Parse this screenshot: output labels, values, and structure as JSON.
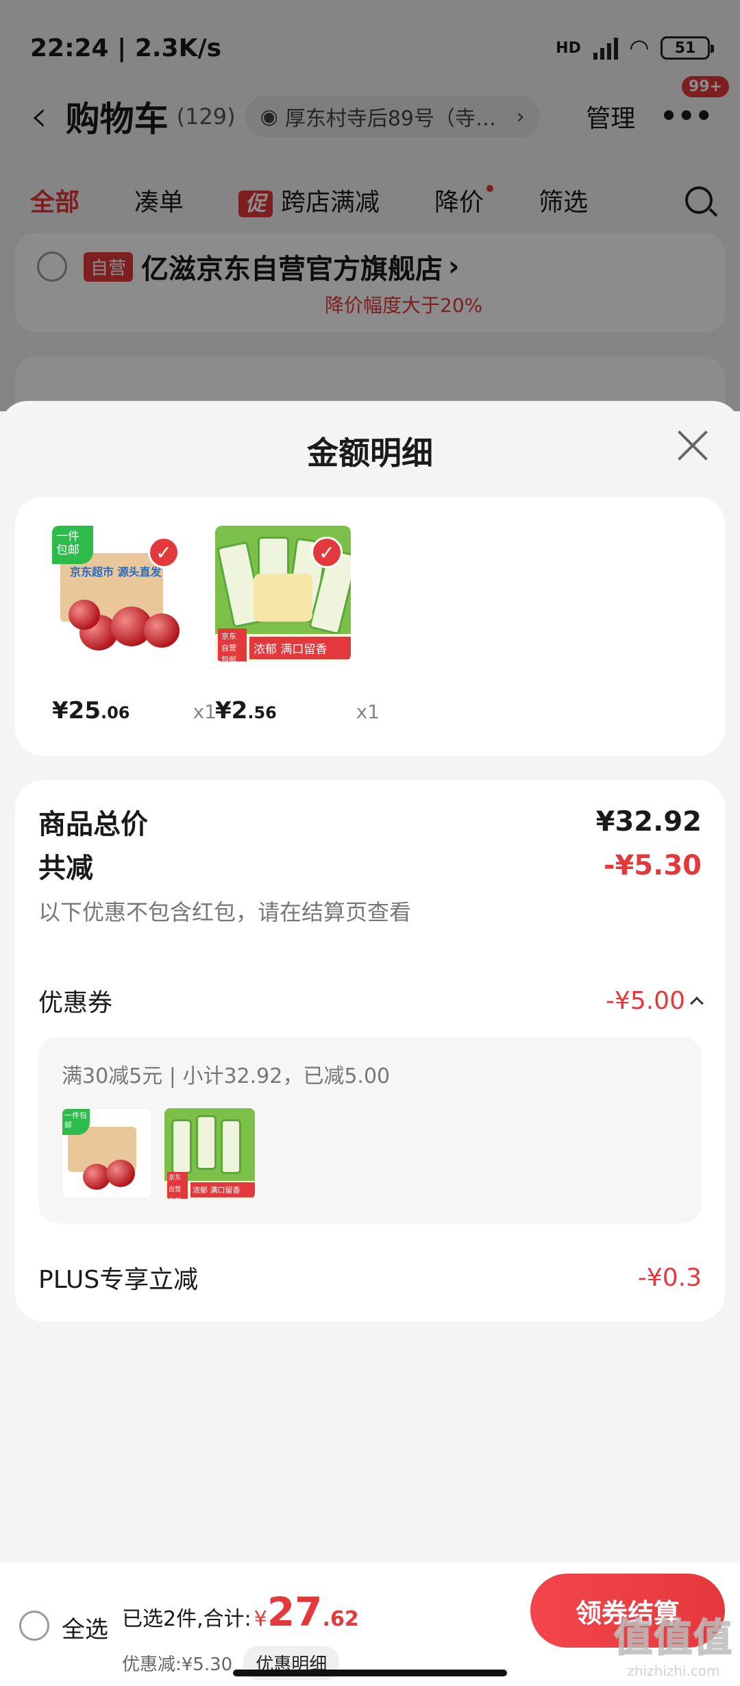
{
  "status_bar": {
    "time": "22:24",
    "speed": "2.3K/s",
    "hd": "HD",
    "network": "6",
    "battery": "51"
  },
  "nav": {
    "title": "购物车",
    "count": "(129)",
    "address": "厚东村寺后89号（寺…",
    "manage": "管理",
    "more_badge": "99+"
  },
  "tabs": [
    {
      "label": "全部"
    },
    {
      "label": "凑单"
    },
    {
      "promo": "促",
      "label": "跨店满减"
    },
    {
      "label": "降价"
    },
    {
      "label": "筛选"
    }
  ],
  "store": {
    "tag": "自营",
    "name": "亿滋京东自营官方旗舰店",
    "subtext": "降价幅度大于20%"
  },
  "sheet": {
    "title": "金额明细",
    "products": [
      {
        "price_int": "¥25",
        "price_dec": ".06",
        "qty": "x1",
        "img_tag": "一件包邮",
        "img_box_text": "京东超市 源头直发"
      },
      {
        "price_int": "¥2",
        "price_dec": ".56",
        "qty": "x1",
        "img_tag_left": "京东自营包邮",
        "img_tag_right": "浓郁 满口留香"
      }
    ],
    "summary": {
      "total_label": "商品总价",
      "total_value": "¥32.92",
      "discount_label": "共减",
      "discount_value": "-¥5.30",
      "hint": "以下优惠不包含红包，请在结算页查看",
      "coupon_label": "优惠券",
      "coupon_value": "-¥5.00",
      "coupon_detail": "满30减5元 | 小计32.92，已减5.00",
      "plus_label": "PLUS专享立减",
      "plus_value": "-¥0.3"
    }
  },
  "bottom": {
    "select_all": "全选",
    "selected_text": "已选2件,合计:",
    "currency": "¥",
    "amount_int": "27",
    "amount_dec": ".62",
    "discount_text": "优惠减:¥5.30",
    "discount_detail": "优惠明细",
    "checkout": "领券结算"
  },
  "watermark": {
    "big": "值值值",
    "small": "zhizhizhi.com"
  },
  "colors": {
    "accent": "#e4393c",
    "background": "#f4f4f4"
  }
}
